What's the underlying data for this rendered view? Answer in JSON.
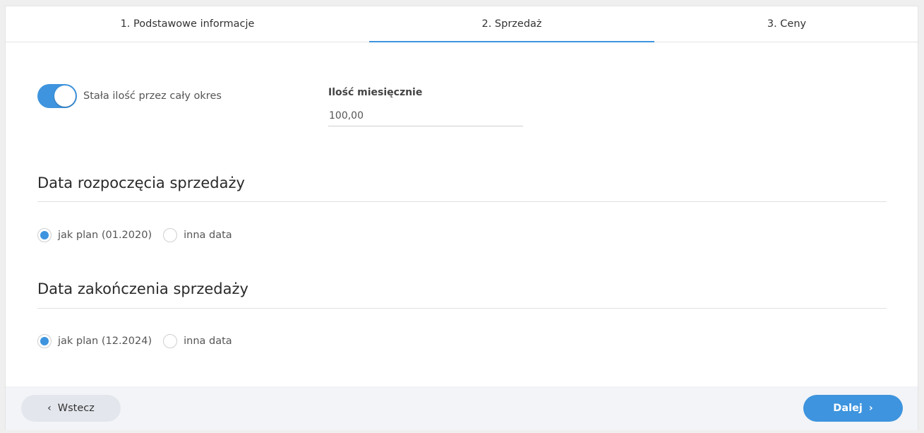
{
  "tabs": [
    {
      "label": "1. Podstawowe informacje",
      "active": false
    },
    {
      "label": "2. Sprzedaż",
      "active": true
    },
    {
      "label": "3. Ceny",
      "active": false
    }
  ],
  "toggle": {
    "label": "Stała ilość przez cały okres",
    "on": true
  },
  "quantity": {
    "label": "Ilość miesięcznie",
    "value": "100,00"
  },
  "start": {
    "title": "Data rozpoczęcia sprzedaży",
    "options": [
      {
        "label": "jak plan (01.2020)",
        "checked": true
      },
      {
        "label": "inna data",
        "checked": false
      }
    ]
  },
  "end": {
    "title": "Data zakończenia sprzedaży",
    "options": [
      {
        "label": "jak plan (12.2024)",
        "checked": true
      },
      {
        "label": "inna data",
        "checked": false
      }
    ]
  },
  "footer": {
    "back_label": "Wstecz",
    "next_label": "Dalej"
  },
  "colors": {
    "accent": "#3e94de",
    "footer_bg": "#f2f4f7",
    "back_button_bg": "#e3e6ec"
  },
  "icons": {
    "back": "chevron-left-icon",
    "next": "chevron-right-icon"
  }
}
